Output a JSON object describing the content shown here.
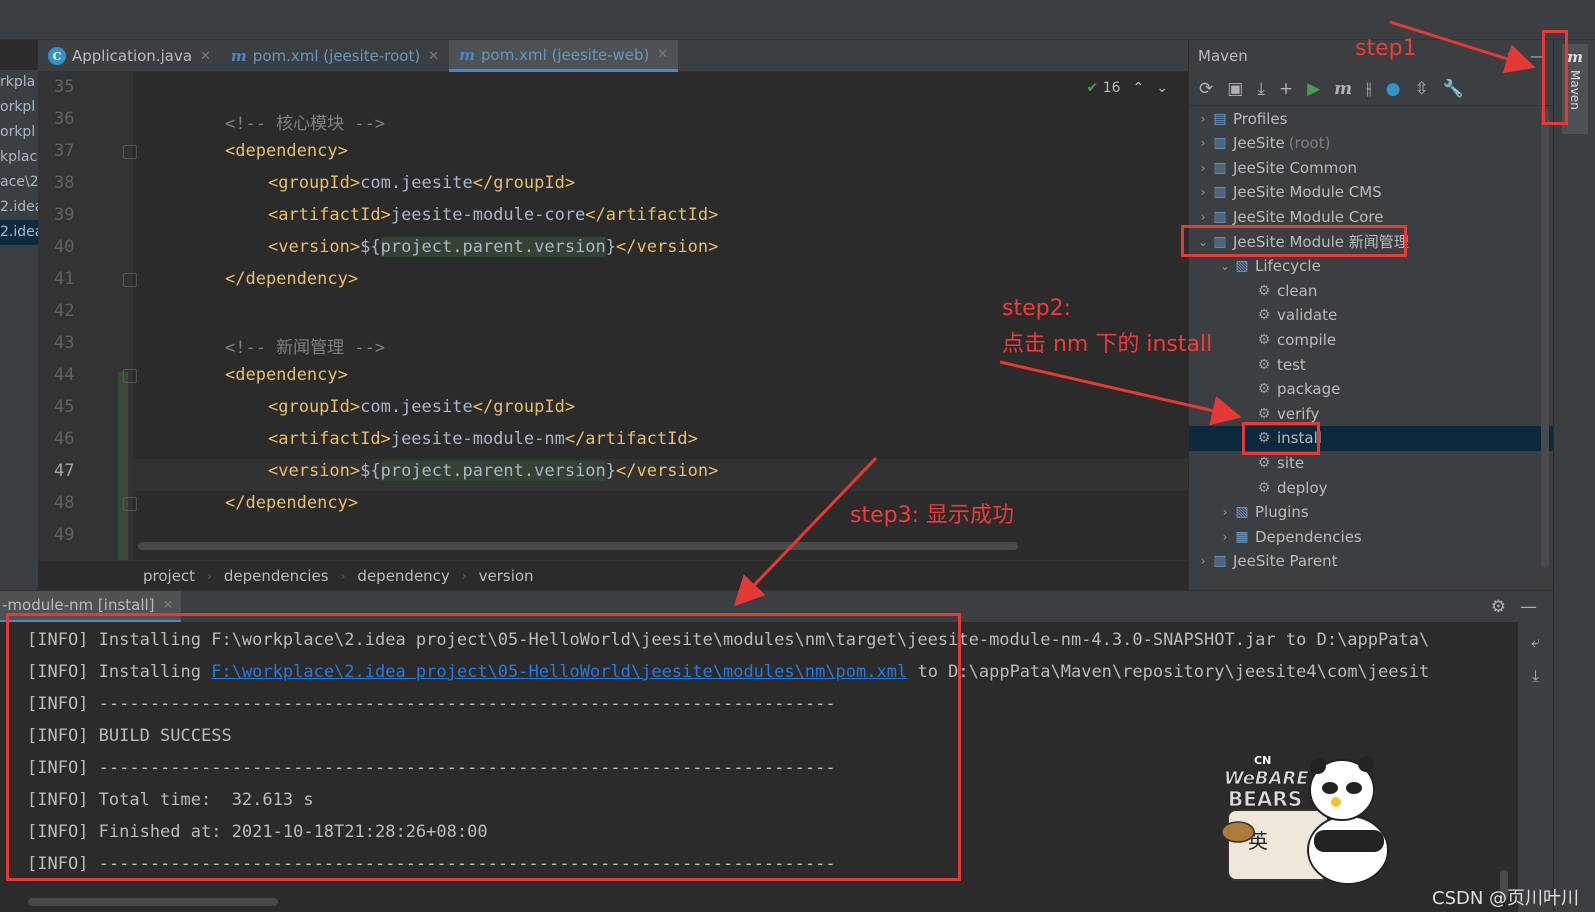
{
  "editor_tabs": [
    {
      "label": "Application.java",
      "icon": "app-class-icon"
    },
    {
      "label": "pom.xml (jeesite-root)",
      "icon": "maven-m-icon"
    },
    {
      "label": "pom.xml (jeesite-web)",
      "icon": "maven-m-icon"
    }
  ],
  "left_project": [
    "rkpla",
    "orkpl",
    "orkpl",
    "kplace",
    "ace\\2",
    "2.idea",
    "2.idea"
  ],
  "editor": {
    "line_numbers": [
      "35",
      "36",
      "37",
      "38",
      "39",
      "40",
      "41",
      "42",
      "43",
      "44",
      "45",
      "46",
      "47",
      "48",
      "49"
    ],
    "current_line": "47",
    "problems_count": "16",
    "lines": {
      "l36": "<!-- 核心模块 -->",
      "l37": "<dependency>",
      "l38_open": "<groupId>",
      "l38_text": "com.jeesite",
      "l38_close": "</groupId>",
      "l39_open": "<artifactId>",
      "l39_text": "jeesite-module-core",
      "l39_close": "</artifactId>",
      "l40_open": "<version>",
      "l40_a": "${",
      "l40_b": "project.parent.version",
      "l40_c": "}",
      "l40_close": "</version>",
      "l41": "</dependency>",
      "l43": "<!-- 新闻管理 -->",
      "l44": "<dependency>",
      "l45_open": "<groupId>",
      "l45_text": "com.jeesite",
      "l45_close": "</groupId>",
      "l46_open": "<artifactId>",
      "l46_text": "jeesite-module-nm",
      "l46_close": "</artifactId>",
      "l47_open": "<version>",
      "l47_a": "${",
      "l47_b": "project.parent.version",
      "l47_c": "}",
      "l47_close": "</version>",
      "l48": "</dependency>"
    }
  },
  "breadcrumb": [
    "project",
    "dependencies",
    "dependency",
    "version"
  ],
  "maven": {
    "title": "Maven",
    "tree": [
      {
        "label": "Profiles",
        "arrow": "›",
        "icon": "profiles-icon"
      },
      {
        "label": "JeeSite",
        "suffix": "(root)",
        "arrow": "›",
        "icon": "maven-module-icon"
      },
      {
        "label": "JeeSite Common",
        "arrow": "›",
        "icon": "maven-module-icon"
      },
      {
        "label": "JeeSite Module CMS",
        "arrow": "›",
        "icon": "maven-module-icon"
      },
      {
        "label": "JeeSite Module Core",
        "arrow": "›",
        "icon": "maven-module-icon"
      },
      {
        "label": "JeeSite Module 新闻管理",
        "arrow": "⌄",
        "icon": "maven-module-icon"
      },
      {
        "label": "Lifecycle",
        "arrow": "⌄",
        "icon": "folder-icon"
      },
      {
        "label": "clean",
        "icon": "gear-icon"
      },
      {
        "label": "validate",
        "icon": "gear-icon"
      },
      {
        "label": "compile",
        "icon": "gear-icon"
      },
      {
        "label": "test",
        "icon": "gear-icon"
      },
      {
        "label": "package",
        "icon": "gear-icon"
      },
      {
        "label": "verify",
        "icon": "gear-icon"
      },
      {
        "label": "install",
        "icon": "gear-icon",
        "selected": true
      },
      {
        "label": "site",
        "icon": "gear-icon"
      },
      {
        "label": "deploy",
        "icon": "gear-icon"
      },
      {
        "label": "Plugins",
        "arrow": "›",
        "icon": "folder-icon"
      },
      {
        "label": "Dependencies",
        "arrow": "›",
        "icon": "dependencies-icon"
      },
      {
        "label": "JeeSite Parent",
        "arrow": "›",
        "icon": "maven-module-icon"
      }
    ],
    "stripe_label": "Maven"
  },
  "run": {
    "tab_label": "-module-nm [install]",
    "console": [
      {
        "a": "[INFO] Installing F:\\workplace\\2.idea project\\05-HelloWorld\\jeesite\\modules\\nm\\target\\jeesite-module-nm-4.3.0-SNAPSHOT.jar to D:\\appPata\\"
      },
      {
        "a": "[INFO] Installing ",
        "link": "F:\\workplace\\2.idea project\\05-HelloWorld\\jeesite\\modules\\nm\\pom.xml",
        "b": " to D:\\appPata\\Maven\\repository\\jeesite4\\com\\jeesit"
      },
      {
        "a": "[INFO] ------------------------------------------------------------------------"
      },
      {
        "a": "[INFO] BUILD SUCCESS"
      },
      {
        "a": "[INFO] ------------------------------------------------------------------------"
      },
      {
        "a": "[INFO] Total time:  32.613 s"
      },
      {
        "a": "[INFO] Finished at: 2021-10-18T21:28:26+08:00"
      },
      {
        "a": "[INFO] ------------------------------------------------------------------------"
      }
    ]
  },
  "annotations": {
    "step1": "step1",
    "step2_line1": "step2:",
    "step2_line2": "点击 nm 下的 install",
    "step3": "step3: 显示成功",
    "color": "#e53935"
  },
  "sticker": {
    "top": "CN",
    "brand_line1": "WeBARE",
    "brand_line2": "BEARS",
    "char": "英"
  },
  "watermark": "CSDN @页川叶川"
}
